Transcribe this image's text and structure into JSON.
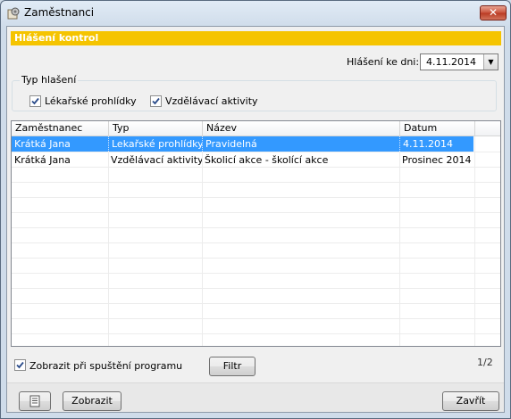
{
  "window": {
    "title": "Zaměstnanci",
    "close_symbol": "✕",
    "icon": "app-gear-icon"
  },
  "section": {
    "title": "Hlášení kontrol",
    "color": "#f5c400"
  },
  "report_date": {
    "label": "Hlášení ke dni:",
    "value": "4.11.2014"
  },
  "report_type": {
    "title": "Typ hlašení",
    "options": [
      {
        "label": "Lékařské prohlídky",
        "checked": true
      },
      {
        "label": "Vzdělávací aktivity",
        "checked": true
      }
    ]
  },
  "grid": {
    "columns": [
      "Zaměstnanec",
      "Typ",
      "Název",
      "Datum"
    ],
    "rows": [
      {
        "employee": "Krátká Jana",
        "type": "Lekařské prohlídky",
        "name": "Pravidelná",
        "date": "4.11.2014",
        "selected": true
      },
      {
        "employee": "Krátká Jana",
        "type": "Vzdělávací aktivity",
        "name": "Školicí akce - školící akce",
        "date": "Prosinec 2014",
        "selected": false
      }
    ],
    "selection_color": "#3399ff"
  },
  "footer": {
    "show_on_startup_label": "Zobrazit při spuštění programu",
    "show_on_startup_checked": true,
    "filter_label": "Filtr",
    "page_indicator": "1/2"
  },
  "bottom_bar": {
    "list_icon": "document-list-icon",
    "show_label": "Zobrazit",
    "close_label": "Zavřít"
  }
}
